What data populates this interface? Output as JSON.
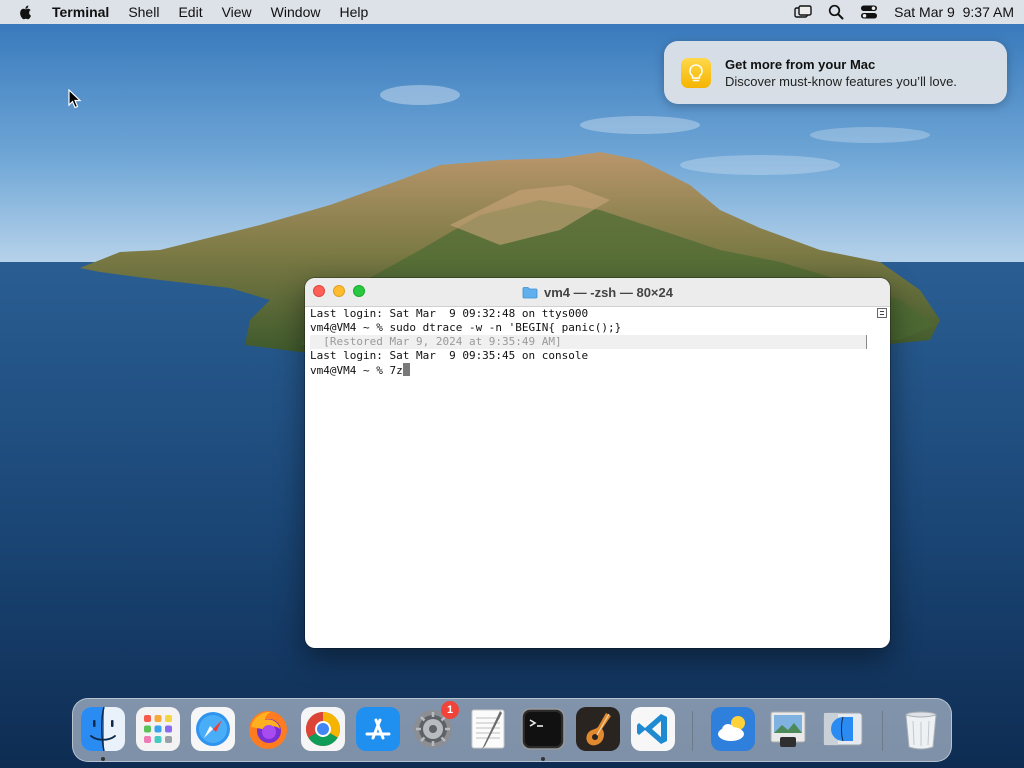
{
  "menubar": {
    "app_name": "Terminal",
    "menus": [
      "Shell",
      "Edit",
      "View",
      "Window",
      "Help"
    ],
    "datetime": "Sat Mar 9  9:37 AM",
    "status_icons": [
      "screen-mirroring-icon",
      "spotlight-search-icon",
      "control-center-icon"
    ]
  },
  "notification": {
    "title": "Get more from your Mac",
    "body": "Discover must-know features you’ll love.",
    "icon": "lightbulb-icon"
  },
  "terminal": {
    "title": "vm4 — -zsh — 80×24",
    "lines": [
      "Last login: Sat Mar  9 09:32:48 on ttys000",
      "vm4@VM4 ~ % sudo dtrace -w -n 'BEGIN{ panic();}",
      "  [Restored Mar 9, 2024 at 9:35:49 AM]",
      "Last login: Sat Mar  9 09:35:45 on console",
      "vm4@VM4 ~ % 7z"
    ]
  },
  "dock": {
    "apps": [
      {
        "name": "Finder",
        "icon": "finder-icon",
        "running": true
      },
      {
        "name": "Launchpad",
        "icon": "launchpad-icon",
        "running": false
      },
      {
        "name": "Safari",
        "icon": "safari-icon",
        "running": false
      },
      {
        "name": "Firefox",
        "icon": "firefox-icon",
        "running": false
      },
      {
        "name": "Google Chrome",
        "icon": "chrome-icon",
        "running": false
      },
      {
        "name": "App Store",
        "icon": "app-store-icon",
        "running": false
      },
      {
        "name": "System Preferences",
        "icon": "system-preferences-icon",
        "running": false,
        "badge": "1"
      },
      {
        "name": "TextEdit",
        "icon": "textedit-icon",
        "running": false
      },
      {
        "name": "Terminal",
        "icon": "terminal-icon",
        "running": true
      },
      {
        "name": "GarageBand",
        "icon": "garageband-icon",
        "running": false
      },
      {
        "name": "Visual Studio Code",
        "icon": "vscode-icon",
        "running": false
      },
      {
        "name": "Weather",
        "icon": "weather-icon",
        "running": false
      },
      {
        "name": "Preview",
        "icon": "preview-icon",
        "running": false
      },
      {
        "name": "Finder (minimized)",
        "icon": "finder-window-icon",
        "running": false
      },
      {
        "name": "Trash",
        "icon": "trash-icon",
        "running": false
      }
    ]
  }
}
